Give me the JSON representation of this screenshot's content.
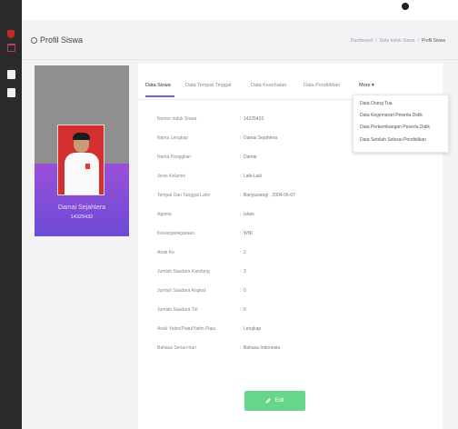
{
  "header": {
    "page_title": "Profil Siswa",
    "breadcrumb": [
      "Dashboard",
      "/",
      "Data Induk Siswa",
      "/",
      "Profil Siswa"
    ]
  },
  "profile": {
    "name": "Damai Sejahtera",
    "nis": "14325432"
  },
  "tabs": [
    {
      "label": "Data Siswa"
    },
    {
      "label": "Data Tempat Tinggal"
    },
    {
      "label": "Data Kesehatan"
    },
    {
      "label": "Data Pendidikan"
    },
    {
      "label": "More ▾"
    }
  ],
  "more_menu": [
    "Data Orang Tua",
    "Data Kegemaran Peserta Didik",
    "Data Perkembangan Peserta Didik",
    "Data Setelah Selesai Pendidikan"
  ],
  "fields": [
    {
      "label": "Nomor Induk Siswa",
      "value": "14325432"
    },
    {
      "label": "Nama Lengkap",
      "value": "Damai Sejahtera"
    },
    {
      "label": "Nama Panggilan",
      "value": "Damai"
    },
    {
      "label": "Jenis Kelamin",
      "value": "Laki-Laki"
    },
    {
      "label": "Tempat Dan Tanggal Lahir",
      "value": "Banyuwangi , 2004-06-07"
    },
    {
      "label": "Agama",
      "value": "Islam"
    },
    {
      "label": "Kewarganegaraan",
      "value": "WNI"
    },
    {
      "label": "Anak Ke",
      "value": "2"
    },
    {
      "label": "Jumlah Saudara Kandung",
      "value": "3"
    },
    {
      "label": "Jumlah Saudara Angkat",
      "value": "0"
    },
    {
      "label": "Jumlah Saudara Tiri",
      "value": "0"
    },
    {
      "label": "Anak Yatim/Piatu/Yatim Piatu",
      "value": "Lengkap"
    },
    {
      "label": "Bahasa Sehari-hari",
      "value": "Bahasa Indonesia"
    }
  ],
  "colon": ":",
  "edit_label": "Edit",
  "icons": {
    "sidebar": [
      "alert-icon",
      "home-icon",
      "file-icon",
      "file-icon"
    ],
    "title": "circle-icon",
    "edit": "pencil-icon"
  },
  "colors": {
    "sidebar": "#2b2b2e",
    "profile_gradient_top": "#9b4fd8",
    "profile_gradient_bottom": "#6c4bd6",
    "tab_active": "#6f63d8",
    "edit_button": "#66d68a"
  }
}
